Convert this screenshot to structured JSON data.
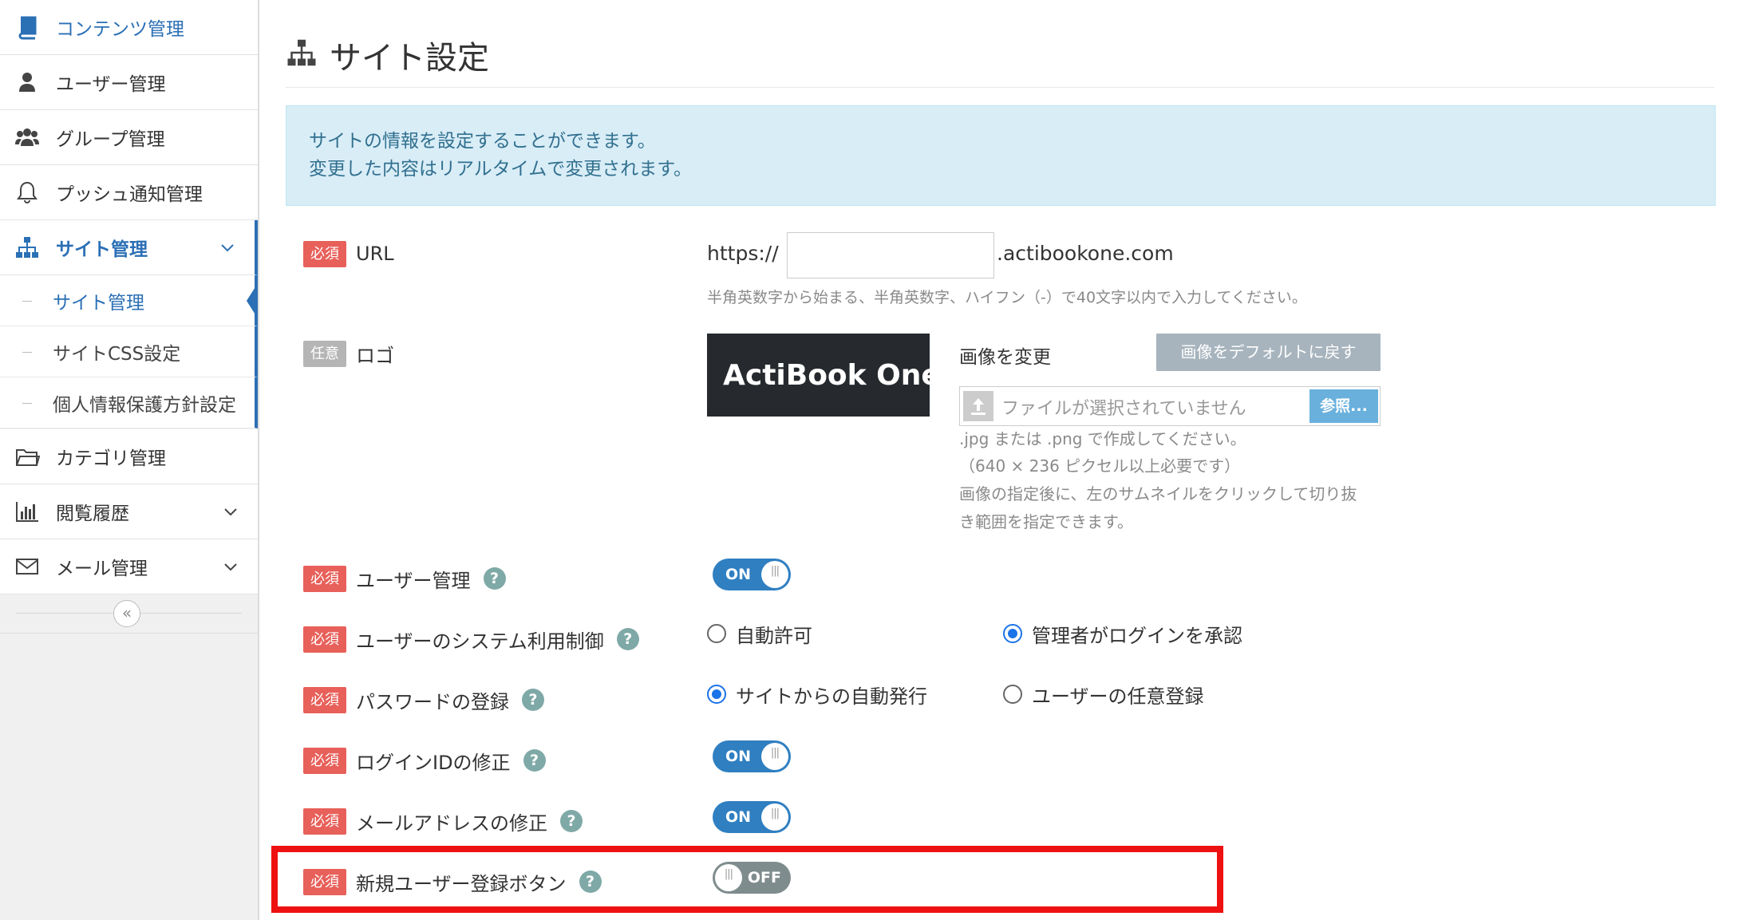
{
  "sidebar": {
    "items": [
      {
        "label": "コンテンツ管理",
        "icon": "book-icon"
      },
      {
        "label": "ユーザー管理",
        "icon": "user-icon"
      },
      {
        "label": "グループ管理",
        "icon": "users-icon"
      },
      {
        "label": "プッシュ通知管理",
        "icon": "bell-icon"
      },
      {
        "label": "サイト管理",
        "icon": "sitemap-icon"
      },
      {
        "label": "カテゴリ管理",
        "icon": "folder-icon"
      },
      {
        "label": "閲覧履歴",
        "icon": "bar-chart-icon"
      },
      {
        "label": "メール管理",
        "icon": "envelope-icon"
      }
    ],
    "sub_items": [
      {
        "label": "サイト管理"
      },
      {
        "label": "サイトCSS設定"
      },
      {
        "label": "個人情報保護方針設定"
      }
    ],
    "collapse_glyph": "«"
  },
  "page": {
    "title": "サイト設定",
    "info_line1": "サイトの情報を設定することができます。",
    "info_line2": "変更した内容はリアルタイムで変更されます。"
  },
  "badges": {
    "required": "必須",
    "optional": "任意"
  },
  "help_glyph": "?",
  "url": {
    "label": "URL",
    "prefix": "https://",
    "value": "",
    "suffix": ".actibookone.com",
    "hint": "半角英数字から始まる、半角英数字、ハイフン（-）で40文字以内で入力してください。"
  },
  "logo": {
    "label": "ロゴ",
    "thumb_text": "ActiBook One",
    "change_label": "画像を変更",
    "reset_button": "画像をデフォルトに戻す",
    "file_placeholder": "ファイルが選択されていません",
    "browse_button": "参照...",
    "hint_lines": [
      ".jpg または .png で作成してください。",
      "（640 × 236 ピクセル以上必要です）",
      "画像の指定後に、左のサムネイルをクリックして切り抜",
      "き範囲を指定できます。"
    ]
  },
  "settings": {
    "user_mgmt": {
      "label": "ユーザー管理",
      "state": "ON"
    },
    "system_control": {
      "label": "ユーザーのシステム利用制御",
      "opt1": "自動許可",
      "opt2": "管理者がログインを承認",
      "selected": "opt2"
    },
    "password": {
      "label": "パスワードの登録",
      "opt1": "サイトからの自動発行",
      "opt2": "ユーザーの任意登録",
      "selected": "opt1"
    },
    "login_id": {
      "label": "ログインIDの修正",
      "state": "ON"
    },
    "email_edit": {
      "label": "メールアドレスの修正",
      "state": "ON"
    },
    "new_user_button": {
      "label": "新規ユーザー登録ボタン",
      "state": "OFF"
    }
  },
  "colors": {
    "accent": "#2b6fb5",
    "toggle_on": "#2f7fc1",
    "toggle_off": "#7f8c8d",
    "required_badge": "#e8605a",
    "highlight": "#ee1111"
  }
}
